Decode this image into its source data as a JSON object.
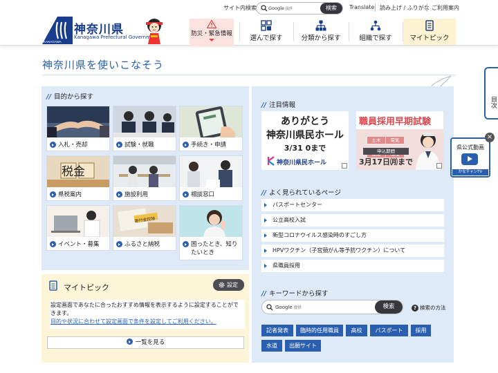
{
  "topbar": {
    "site_search_label": "サイト内検索",
    "search_placeholder": "Google",
    "search_enhanced": "提供",
    "search_button": "検索",
    "translate": "Translate",
    "read_aloud": "読み上げ / ふりがな",
    "usage_guide": "ご利用案内"
  },
  "header": {
    "logo_title": "神奈川県",
    "logo_subtitle": "Kanagawa Prefectural Government",
    "logo_mark_text": "KANAGAWA",
    "disaster_label": "防災・緊急情報",
    "nav": [
      {
        "label": "選んで探す",
        "icon": "grid-icon"
      },
      {
        "label": "分類から探す",
        "icon": "tree-icon"
      },
      {
        "label": "組織で探す",
        "icon": "org-icon"
      },
      {
        "label": "マイトピック",
        "icon": "book-icon"
      }
    ]
  },
  "page_title": "神奈川県を使いこなそう",
  "purpose": {
    "heading": "目的から探す",
    "cards": [
      {
        "label": "入札・売却"
      },
      {
        "label": "試験・就職"
      },
      {
        "label": "手続き・申請"
      },
      {
        "label": "県税案内",
        "image_text": "税金"
      },
      {
        "label": "施設利用"
      },
      {
        "label": "相談窓口"
      },
      {
        "label": "イベント・募集"
      },
      {
        "label": "ふるさと納税",
        "image_text": "寄付金控除"
      },
      {
        "label": "困ったとき、知りたいとき"
      }
    ]
  },
  "mytopic": {
    "title": "マイトピック",
    "settings_label": "設定",
    "body_text": "設定画面であなたに合ったおすすめ情報を表示するように設定することができます。",
    "body_link": "目的や状況に合わせて設定画面で条件を設定してご利用ください。",
    "more_label": "一覧を見る"
  },
  "notice": {
    "heading": "注目情報",
    "banner1": {
      "line1": "ありがとう",
      "line2": "神奈川県民ホール",
      "line3": "3/31 0まで",
      "logo": "神奈川県民ホール"
    },
    "banner2": {
      "title": "職員採用早期試験",
      "chips": [
        "土木",
        "電気",
        "建築",
        "福祉"
      ],
      "period": "申込期間",
      "date": "3月17日㈪まで"
    }
  },
  "popular": {
    "heading": "よく見られているページ",
    "items": [
      "パスポートセンター",
      "公立高校入試",
      "新型コロナウイルス感染時のすごし方",
      "HPVワクチン（子宮頸がん等予防ワクチン）について",
      "県職員採用"
    ]
  },
  "keyword": {
    "heading": "キーワードから探す",
    "search_placeholder": "Google",
    "search_enhanced": "提供",
    "search_button": "検索",
    "help_label": "検索の方法",
    "tags": [
      "記者発表",
      "臨時的任用職員",
      "高校",
      "パスポート",
      "採用",
      "水道",
      "出願サイト"
    ]
  },
  "side": {
    "tab_label": "目次",
    "video_title": "県公式動画",
    "video_channel": "かなチャンTV",
    "close": "×"
  },
  "colors": {
    "primary": "#2a5fb0",
    "panel": "#dfeaf8",
    "mytopic_bg": "#fdf5d8",
    "disaster_bg": "#fde3e0"
  }
}
